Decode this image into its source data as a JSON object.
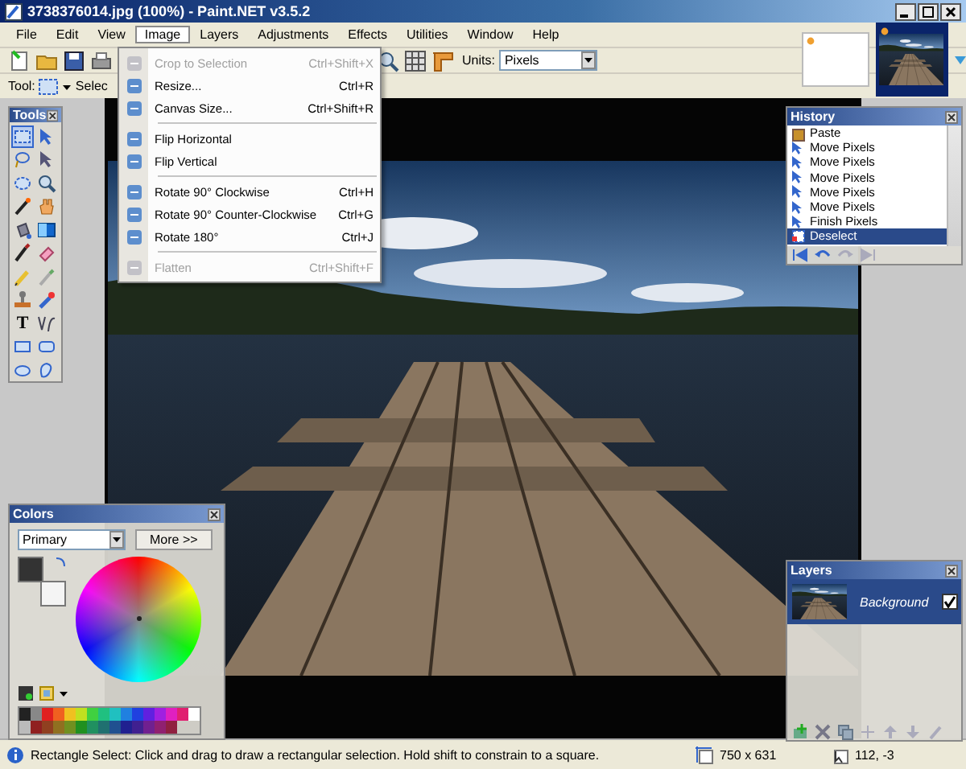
{
  "window": {
    "title": "3738376014.jpg (100%) - Paint.NET v3.5.2"
  },
  "menu_bar": [
    {
      "label": "File",
      "selected": false
    },
    {
      "label": "Edit",
      "selected": false
    },
    {
      "label": "View",
      "selected": false
    },
    {
      "label": "Image",
      "selected": true
    },
    {
      "label": "Layers",
      "selected": false
    },
    {
      "label": "Adjustments",
      "selected": false
    },
    {
      "label": "Effects",
      "selected": false
    },
    {
      "label": "Utilities",
      "selected": false
    },
    {
      "label": "Window",
      "selected": false
    },
    {
      "label": "Help",
      "selected": false
    }
  ],
  "image_menu": [
    {
      "kind": "item",
      "label": "Crop to Selection",
      "shortcut": "Ctrl+Shift+X",
      "disabled": true
    },
    {
      "kind": "item",
      "label": "Resize...",
      "shortcut": "Ctrl+R",
      "disabled": false
    },
    {
      "kind": "item",
      "label": "Canvas Size...",
      "shortcut": "Ctrl+Shift+R",
      "disabled": false
    },
    {
      "kind": "separator"
    },
    {
      "kind": "item",
      "label": "Flip Horizontal",
      "disabled": false
    },
    {
      "kind": "item",
      "label": "Flip Vertical",
      "disabled": false
    },
    {
      "kind": "separator"
    },
    {
      "kind": "item",
      "label": "Rotate 90° Clockwise",
      "shortcut": "Ctrl+H",
      "disabled": false
    },
    {
      "kind": "item",
      "label": "Rotate 90° Counter-Clockwise",
      "shortcut": "Ctrl+G",
      "disabled": false
    },
    {
      "kind": "item",
      "label": "Rotate 180°",
      "shortcut": "Ctrl+J",
      "disabled": false
    },
    {
      "kind": "separator"
    },
    {
      "kind": "item",
      "label": "Flatten",
      "shortcut": "Ctrl+Shift+F",
      "disabled": true
    }
  ],
  "toolbar": {
    "units_label": "Units:",
    "units_value": "Pixels",
    "tool_label": "Tool:",
    "tool_option": "Selec"
  },
  "thumbnails": [
    {
      "kind": "blank",
      "selected": false
    },
    {
      "kind": "photo",
      "selected": true
    }
  ],
  "tools_panel": {
    "title": "Tools",
    "tools": [
      {
        "kind": "rect-select",
        "selected": true
      },
      {
        "kind": "move-selected",
        "selected": false
      },
      {
        "kind": "lasso",
        "selected": false
      },
      {
        "kind": "move-selection",
        "selected": false
      },
      {
        "kind": "ellipse-select",
        "selected": false
      },
      {
        "kind": "zoom",
        "selected": false
      },
      {
        "kind": "wand",
        "selected": false
      },
      {
        "kind": "pan",
        "selected": false
      },
      {
        "kind": "bucket",
        "selected": false
      },
      {
        "kind": "gradient",
        "selected": false
      },
      {
        "kind": "brush",
        "selected": false
      },
      {
        "kind": "eraser",
        "selected": false
      },
      {
        "kind": "pencil",
        "selected": false
      },
      {
        "kind": "picker",
        "selected": false
      },
      {
        "kind": "stamp",
        "selected": false
      },
      {
        "kind": "recolor",
        "selected": false
      },
      {
        "kind": "text",
        "glyph": "T",
        "selected": false
      },
      {
        "kind": "line",
        "selected": false
      },
      {
        "kind": "rectangle",
        "selected": false
      },
      {
        "kind": "rounded-rect",
        "selected": false
      },
      {
        "kind": "ellipse",
        "selected": false
      },
      {
        "kind": "freeform",
        "selected": false
      }
    ]
  },
  "history_panel": {
    "title": "History",
    "items": [
      {
        "label": "Paste",
        "kind": "paste",
        "selected": false
      },
      {
        "label": "Move Pixels",
        "kind": "move",
        "selected": false
      },
      {
        "label": "Move Pixels",
        "kind": "move",
        "selected": false
      },
      {
        "label": "Move Pixels",
        "kind": "move",
        "selected": false
      },
      {
        "label": "Move Pixels",
        "kind": "move",
        "selected": false
      },
      {
        "label": "Move Pixels",
        "kind": "move",
        "selected": false
      },
      {
        "label": "Finish Pixels",
        "kind": "move",
        "selected": false
      },
      {
        "label": "Deselect",
        "kind": "deselect",
        "selected": true
      }
    ]
  },
  "colors_panel": {
    "title": "Colors",
    "dropdown": "Primary",
    "more_button": "More >>",
    "swatches": [
      {
        "kind": "primary",
        "color": "#333333"
      },
      {
        "kind": "secondary",
        "color": "#f4f4f4"
      }
    ]
  },
  "layers_panel": {
    "title": "Layers",
    "layers": [
      {
        "name": "Background",
        "selected": true,
        "visible": true
      }
    ]
  },
  "status_bar": {
    "message": "Rectangle Select: Click and drag to draw a rectangular selection. Hold shift to constrain to a square.",
    "image_size": "750 x 631",
    "cursor": "112, -3"
  }
}
